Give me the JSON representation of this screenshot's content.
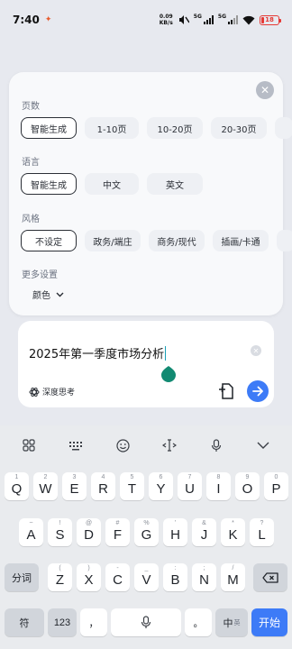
{
  "status_bar": {
    "time": "7:40",
    "notification": "✦",
    "net_speed_value": "0.09",
    "net_speed_unit": "KB/s",
    "network_5g": "5G",
    "battery": "18",
    "battery_color": "#e53935"
  },
  "settings": {
    "pages": {
      "label": "页数",
      "options": [
        "智能生成",
        "1-10页",
        "10-20页",
        "20-30页"
      ],
      "selected_index": 0
    },
    "language": {
      "label": "语言",
      "options": [
        "智能生成",
        "中文",
        "英文"
      ],
      "selected_index": 0
    },
    "style": {
      "label": "风格",
      "options": [
        "不设定",
        "政务/端庄",
        "商务/现代",
        "插画/卡通"
      ],
      "selected_index": 0
    },
    "more": {
      "label": "更多设置",
      "color_select": "颜色"
    }
  },
  "input": {
    "value": "2025年第一季度市场分析",
    "deep_think_label": "深度思考",
    "accent_color": "#3d7bf7"
  },
  "keyboard": {
    "toolbar_icons": [
      "grid-icon",
      "keyboard-icon",
      "emoji-icon",
      "cursor-move-icon",
      "mic-icon",
      "collapse-icon"
    ],
    "row1": [
      {
        "main": "Q",
        "sub": "1"
      },
      {
        "main": "W",
        "sub": "2"
      },
      {
        "main": "E",
        "sub": "3"
      },
      {
        "main": "R",
        "sub": "4"
      },
      {
        "main": "T",
        "sub": "5"
      },
      {
        "main": "Y",
        "sub": "6"
      },
      {
        "main": "U",
        "sub": "7"
      },
      {
        "main": "I",
        "sub": "8"
      },
      {
        "main": "O",
        "sub": "9"
      },
      {
        "main": "P",
        "sub": "0"
      }
    ],
    "row2": [
      {
        "main": "A",
        "sub": "~"
      },
      {
        "main": "S",
        "sub": "!"
      },
      {
        "main": "D",
        "sub": "@"
      },
      {
        "main": "F",
        "sub": "#"
      },
      {
        "main": "G",
        "sub": "%"
      },
      {
        "main": "H",
        "sub": "'"
      },
      {
        "main": "J",
        "sub": "&"
      },
      {
        "main": "K",
        "sub": "*"
      },
      {
        "main": "L",
        "sub": "?"
      }
    ],
    "row3": [
      {
        "main": "Z",
        "sub": "("
      },
      {
        "main": "X",
        "sub": ")"
      },
      {
        "main": "C",
        "sub": "-"
      },
      {
        "main": "V",
        "sub": "_"
      },
      {
        "main": "B",
        "sub": ":"
      },
      {
        "main": "N",
        "sub": ";"
      },
      {
        "main": "M",
        "sub": "/"
      }
    ],
    "segment_key": "分词",
    "symbol_key": "符",
    "number_key": "123",
    "comma_key": "，",
    "period_key": "。",
    "lang_key": "中",
    "lang_key_sub": "英",
    "start_key": "开始"
  }
}
